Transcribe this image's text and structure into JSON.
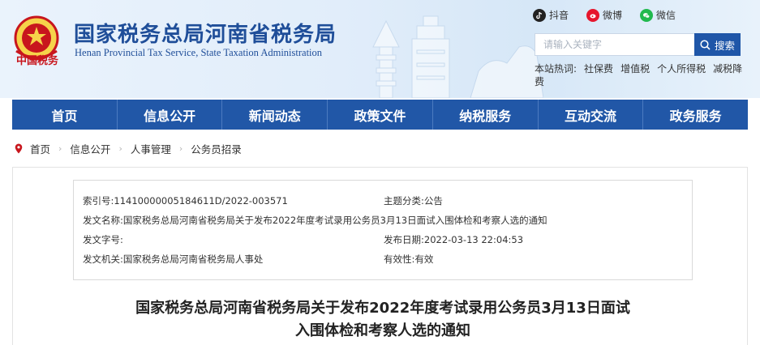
{
  "header": {
    "logo_text": "中国税务",
    "title_cn": "国家税务总局河南省税务局",
    "title_en": "Henan Provincial Tax Service, State Taxation Administration"
  },
  "socials": [
    {
      "label": "抖音",
      "icon": "douyin-icon"
    },
    {
      "label": "微博",
      "icon": "weibo-icon"
    },
    {
      "label": "微信",
      "icon": "wechat-icon"
    }
  ],
  "search": {
    "placeholder": "请输入关键字",
    "button_label": "搜索"
  },
  "hotwords": {
    "label": "本站热词:",
    "items": [
      "社保费",
      "增值税",
      "个人所得税",
      "减税降费"
    ]
  },
  "nav": {
    "items": [
      "首页",
      "信息公开",
      "新闻动态",
      "政策文件",
      "纳税服务",
      "互动交流",
      "政务服务"
    ]
  },
  "breadcrumb": [
    "首页",
    "信息公开",
    "人事管理",
    "公务员招录"
  ],
  "meta": {
    "index_label": "索引号:",
    "index_value": "11410000005184611D/2022-003571",
    "topic_label": "主题分类:",
    "topic_value": "公告",
    "name_label": "发文名称:",
    "name_value": "国家税务总局河南省税务局关于发布2022年度考试录用公务员3月13日面试入围体检和考察人选的通知",
    "docno_label": "发文字号:",
    "docno_value": "",
    "date_label": "发布日期:",
    "date_value": "2022-03-13 22:04:53",
    "org_label": "发文机关:",
    "org_value": "国家税务总局河南省税务局人事处",
    "valid_label": "有效性:",
    "valid_value": "有效"
  },
  "article": {
    "title_line1": "国家税务总局河南省税务局关于发布2022年度考试录用公务员3月13日面试",
    "title_line2": "入围体检和考察人选的通知"
  },
  "colors": {
    "nav_bg": "#2157a7",
    "title_blue": "#1f4e99",
    "search_btn": "#1f56a8",
    "logo_red": "#c8161d"
  }
}
